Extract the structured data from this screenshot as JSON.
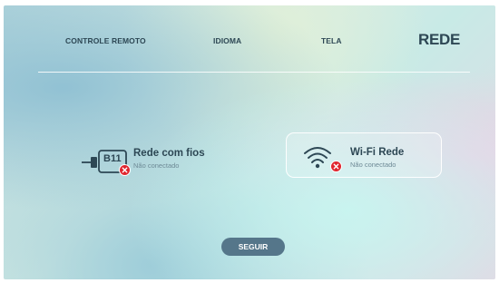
{
  "tabs": [
    {
      "label": "CONTROLE REMOTO",
      "active": false
    },
    {
      "label": "IDIOMA",
      "active": false
    },
    {
      "label": "TELA",
      "active": false
    },
    {
      "label": "REDE",
      "active": true
    }
  ],
  "network": {
    "wired": {
      "title": "Rede com fios",
      "status": "Não conectado",
      "port_label": "B11",
      "icon": "ethernet-port-icon"
    },
    "wifi": {
      "title": "Wi-Fi Rede",
      "status": "Não conectado",
      "icon": "wifi-icon"
    }
  },
  "actions": {
    "next_label": "SEGUIR"
  },
  "colors": {
    "text": "#2d4754",
    "subtext": "#6e8a96",
    "button": "#55768a",
    "error": "#e0262f"
  }
}
